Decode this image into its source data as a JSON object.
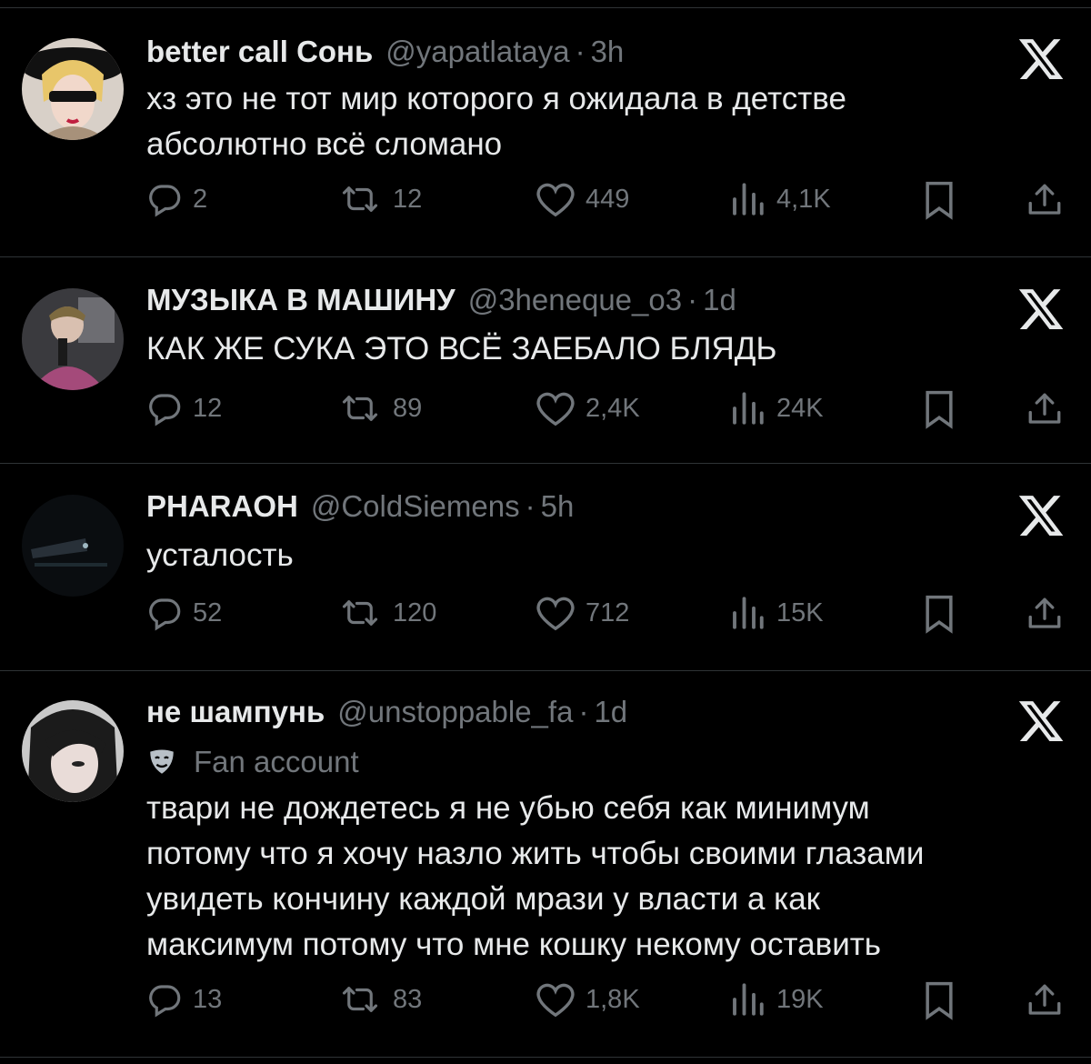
{
  "tweets": [
    {
      "name": "better call Сонь",
      "handle": "@yapatlataya",
      "dot": "·",
      "time": "3h",
      "text": "хз это не тот мир которого я ожидала в детстве\nабсолютно всё сломано",
      "badge": "",
      "replies": "2",
      "reposts": "12",
      "likes": "449",
      "views": "4,1K"
    },
    {
      "name": "МУЗЫКА В МАШИНУ",
      "handle": "@3heneque_o3",
      "dot": "·",
      "time": "1d",
      "text": "КАК ЖЕ СУКА ЭТО ВСЁ ЗАЕБАЛО БЛЯДЬ",
      "badge": "",
      "replies": "12",
      "reposts": "89",
      "likes": "2,4K",
      "views": "24K"
    },
    {
      "name": "PHARAOH",
      "handle": "@ColdSiemens",
      "dot": "·",
      "time": "5h",
      "text": "усталость",
      "badge": "",
      "replies": "52",
      "reposts": "120",
      "likes": "712",
      "views": "15K"
    },
    {
      "name": "не шампунь",
      "handle": "@unstoppable_fa",
      "dot": "·",
      "time": "1d",
      "badge": "Fan account",
      "text": "твари не дождетесь я не убью себя как минимум\nпотому что я хочу назло жить чтобы своими глазами\nувидеть кончину каждой мрази у власти а как\nмаксимум потому что мне кошку некому оставить",
      "replies": "13",
      "reposts": "83",
      "likes": "1,8K",
      "views": "19K"
    }
  ],
  "icons": {
    "reply": "reply-icon",
    "repost": "repost-icon",
    "like": "heart-icon",
    "views": "views-icon",
    "bookmark": "bookmark-icon",
    "share": "share-icon",
    "x": "x-logo-icon",
    "fan": "theater-masks-icon"
  },
  "colors": {
    "background": "#000000",
    "text": "#e7e9ea",
    "secondary": "#71767b",
    "divider": "#2f3336"
  }
}
